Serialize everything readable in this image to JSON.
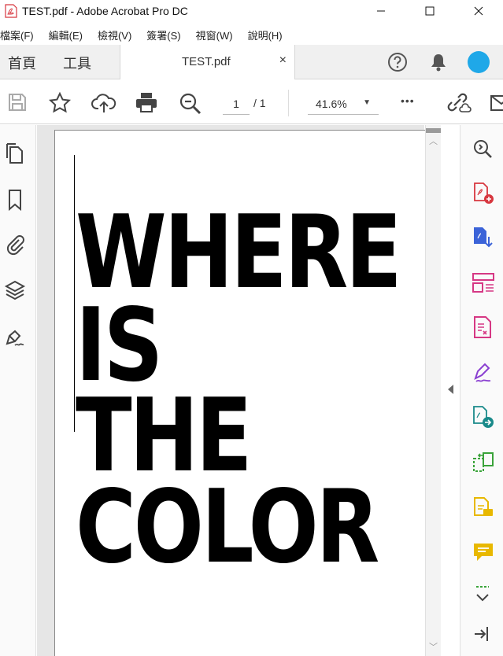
{
  "window": {
    "title": "TEST.pdf - Adobe Acrobat Pro DC"
  },
  "menu": {
    "items": [
      "檔案(F)",
      "編輯(E)",
      "檢視(V)",
      "簽署(S)",
      "視窗(W)",
      "說明(H)"
    ]
  },
  "tabs": {
    "home": "首頁",
    "tools": "工具",
    "document": "TEST.pdf",
    "close": "×"
  },
  "toolbar": {
    "page_current": "1",
    "page_total": "/ 1",
    "zoom": "41.6%",
    "more": "•••"
  },
  "document": {
    "lines": [
      "WHERE",
      "IS",
      "THE",
      "COLOR"
    ]
  },
  "colors": {
    "avatar": "#1fa8e8",
    "acrobat_red": "#d7373f",
    "tool_blue": "#3b63d8",
    "tool_pink": "#d63884",
    "tool_purple": "#8a3fd1",
    "tool_teal": "#1a8a8a",
    "tool_green": "#3aa33a",
    "tool_yellow": "#e8b800"
  }
}
